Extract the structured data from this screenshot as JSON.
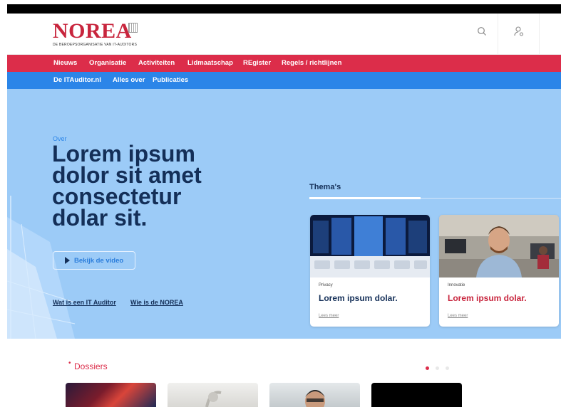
{
  "logo": {
    "word": "NOREA",
    "tagline": "DE BEROEPSORGANISATIE VAN IT-AUDITORS"
  },
  "header": {
    "search_icon": "search-icon",
    "account_icon": "user-icon"
  },
  "nav_primary": [
    "Nieuws",
    "Organisatie",
    "Activiteiten",
    "Lidmaatschap",
    "REgister",
    "Regels / richtlijnen"
  ],
  "nav_secondary": [
    "De ITAuditor.nl",
    "Alles over",
    "Publicaties"
  ],
  "hero": {
    "kicker": "Over",
    "title": "Lorem ipsum dolor sit amet consectetur dolar sit.",
    "video_button": "Bekijk de video",
    "links": [
      "Wat is een IT Auditor",
      "Wie is de NOREA"
    ]
  },
  "themas": {
    "label": "Thema's",
    "cards": [
      {
        "category": "Privacy",
        "title": "Lorem ipsum dolar.",
        "more": "Lees meer",
        "title_color": "#142f58"
      },
      {
        "category": "Innovatie",
        "title": "Lorem ipsum dolar.",
        "more": "Lees meer",
        "title_color": "#c8253d"
      }
    ]
  },
  "dossiers": {
    "marker": "•",
    "label": "Dossiers",
    "pager_active": 1,
    "pager_total": 3
  },
  "colors": {
    "brand_red": "#dc2d4a",
    "brand_blue": "#2b85e8",
    "navy": "#142f58",
    "hero_bg": "#9ccbf7"
  }
}
